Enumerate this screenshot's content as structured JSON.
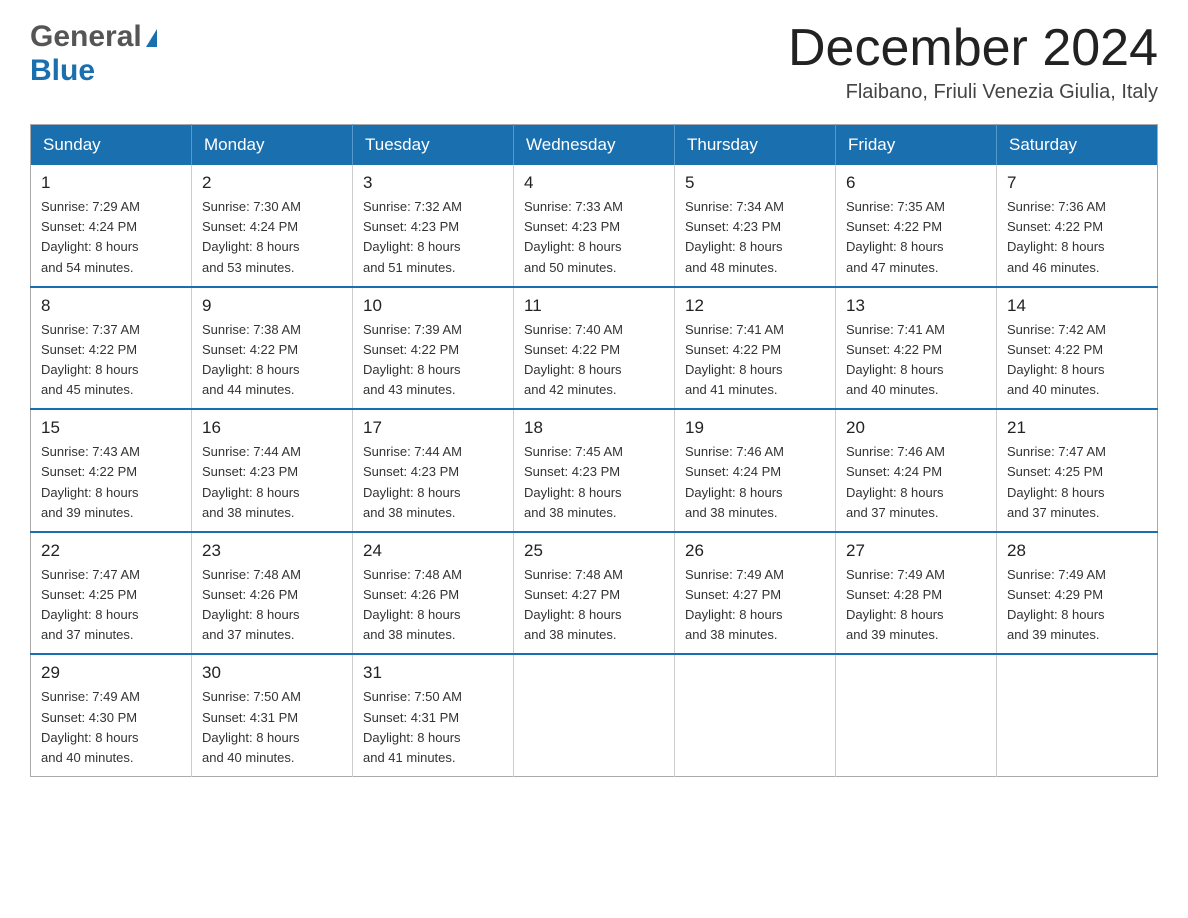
{
  "header": {
    "logo_general": "General",
    "logo_blue": "Blue",
    "month_year": "December 2024",
    "location": "Flaibano, Friuli Venezia Giulia, Italy"
  },
  "days_of_week": [
    "Sunday",
    "Monday",
    "Tuesday",
    "Wednesday",
    "Thursday",
    "Friday",
    "Saturday"
  ],
  "weeks": [
    [
      {
        "day": 1,
        "sunrise": "Sunrise: 7:29 AM",
        "sunset": "Sunset: 4:24 PM",
        "daylight": "Daylight: 8 hours",
        "daylight2": "and 54 minutes."
      },
      {
        "day": 2,
        "sunrise": "Sunrise: 7:30 AM",
        "sunset": "Sunset: 4:24 PM",
        "daylight": "Daylight: 8 hours",
        "daylight2": "and 53 minutes."
      },
      {
        "day": 3,
        "sunrise": "Sunrise: 7:32 AM",
        "sunset": "Sunset: 4:23 PM",
        "daylight": "Daylight: 8 hours",
        "daylight2": "and 51 minutes."
      },
      {
        "day": 4,
        "sunrise": "Sunrise: 7:33 AM",
        "sunset": "Sunset: 4:23 PM",
        "daylight": "Daylight: 8 hours",
        "daylight2": "and 50 minutes."
      },
      {
        "day": 5,
        "sunrise": "Sunrise: 7:34 AM",
        "sunset": "Sunset: 4:23 PM",
        "daylight": "Daylight: 8 hours",
        "daylight2": "and 48 minutes."
      },
      {
        "day": 6,
        "sunrise": "Sunrise: 7:35 AM",
        "sunset": "Sunset: 4:22 PM",
        "daylight": "Daylight: 8 hours",
        "daylight2": "and 47 minutes."
      },
      {
        "day": 7,
        "sunrise": "Sunrise: 7:36 AM",
        "sunset": "Sunset: 4:22 PM",
        "daylight": "Daylight: 8 hours",
        "daylight2": "and 46 minutes."
      }
    ],
    [
      {
        "day": 8,
        "sunrise": "Sunrise: 7:37 AM",
        "sunset": "Sunset: 4:22 PM",
        "daylight": "Daylight: 8 hours",
        "daylight2": "and 45 minutes."
      },
      {
        "day": 9,
        "sunrise": "Sunrise: 7:38 AM",
        "sunset": "Sunset: 4:22 PM",
        "daylight": "Daylight: 8 hours",
        "daylight2": "and 44 minutes."
      },
      {
        "day": 10,
        "sunrise": "Sunrise: 7:39 AM",
        "sunset": "Sunset: 4:22 PM",
        "daylight": "Daylight: 8 hours",
        "daylight2": "and 43 minutes."
      },
      {
        "day": 11,
        "sunrise": "Sunrise: 7:40 AM",
        "sunset": "Sunset: 4:22 PM",
        "daylight": "Daylight: 8 hours",
        "daylight2": "and 42 minutes."
      },
      {
        "day": 12,
        "sunrise": "Sunrise: 7:41 AM",
        "sunset": "Sunset: 4:22 PM",
        "daylight": "Daylight: 8 hours",
        "daylight2": "and 41 minutes."
      },
      {
        "day": 13,
        "sunrise": "Sunrise: 7:41 AM",
        "sunset": "Sunset: 4:22 PM",
        "daylight": "Daylight: 8 hours",
        "daylight2": "and 40 minutes."
      },
      {
        "day": 14,
        "sunrise": "Sunrise: 7:42 AM",
        "sunset": "Sunset: 4:22 PM",
        "daylight": "Daylight: 8 hours",
        "daylight2": "and 40 minutes."
      }
    ],
    [
      {
        "day": 15,
        "sunrise": "Sunrise: 7:43 AM",
        "sunset": "Sunset: 4:22 PM",
        "daylight": "Daylight: 8 hours",
        "daylight2": "and 39 minutes."
      },
      {
        "day": 16,
        "sunrise": "Sunrise: 7:44 AM",
        "sunset": "Sunset: 4:23 PM",
        "daylight": "Daylight: 8 hours",
        "daylight2": "and 38 minutes."
      },
      {
        "day": 17,
        "sunrise": "Sunrise: 7:44 AM",
        "sunset": "Sunset: 4:23 PM",
        "daylight": "Daylight: 8 hours",
        "daylight2": "and 38 minutes."
      },
      {
        "day": 18,
        "sunrise": "Sunrise: 7:45 AM",
        "sunset": "Sunset: 4:23 PM",
        "daylight": "Daylight: 8 hours",
        "daylight2": "and 38 minutes."
      },
      {
        "day": 19,
        "sunrise": "Sunrise: 7:46 AM",
        "sunset": "Sunset: 4:24 PM",
        "daylight": "Daylight: 8 hours",
        "daylight2": "and 38 minutes."
      },
      {
        "day": 20,
        "sunrise": "Sunrise: 7:46 AM",
        "sunset": "Sunset: 4:24 PM",
        "daylight": "Daylight: 8 hours",
        "daylight2": "and 37 minutes."
      },
      {
        "day": 21,
        "sunrise": "Sunrise: 7:47 AM",
        "sunset": "Sunset: 4:25 PM",
        "daylight": "Daylight: 8 hours",
        "daylight2": "and 37 minutes."
      }
    ],
    [
      {
        "day": 22,
        "sunrise": "Sunrise: 7:47 AM",
        "sunset": "Sunset: 4:25 PM",
        "daylight": "Daylight: 8 hours",
        "daylight2": "and 37 minutes."
      },
      {
        "day": 23,
        "sunrise": "Sunrise: 7:48 AM",
        "sunset": "Sunset: 4:26 PM",
        "daylight": "Daylight: 8 hours",
        "daylight2": "and 37 minutes."
      },
      {
        "day": 24,
        "sunrise": "Sunrise: 7:48 AM",
        "sunset": "Sunset: 4:26 PM",
        "daylight": "Daylight: 8 hours",
        "daylight2": "and 38 minutes."
      },
      {
        "day": 25,
        "sunrise": "Sunrise: 7:48 AM",
        "sunset": "Sunset: 4:27 PM",
        "daylight": "Daylight: 8 hours",
        "daylight2": "and 38 minutes."
      },
      {
        "day": 26,
        "sunrise": "Sunrise: 7:49 AM",
        "sunset": "Sunset: 4:27 PM",
        "daylight": "Daylight: 8 hours",
        "daylight2": "and 38 minutes."
      },
      {
        "day": 27,
        "sunrise": "Sunrise: 7:49 AM",
        "sunset": "Sunset: 4:28 PM",
        "daylight": "Daylight: 8 hours",
        "daylight2": "and 39 minutes."
      },
      {
        "day": 28,
        "sunrise": "Sunrise: 7:49 AM",
        "sunset": "Sunset: 4:29 PM",
        "daylight": "Daylight: 8 hours",
        "daylight2": "and 39 minutes."
      }
    ],
    [
      {
        "day": 29,
        "sunrise": "Sunrise: 7:49 AM",
        "sunset": "Sunset: 4:30 PM",
        "daylight": "Daylight: 8 hours",
        "daylight2": "and 40 minutes."
      },
      {
        "day": 30,
        "sunrise": "Sunrise: 7:50 AM",
        "sunset": "Sunset: 4:31 PM",
        "daylight": "Daylight: 8 hours",
        "daylight2": "and 40 minutes."
      },
      {
        "day": 31,
        "sunrise": "Sunrise: 7:50 AM",
        "sunset": "Sunset: 4:31 PM",
        "daylight": "Daylight: 8 hours",
        "daylight2": "and 41 minutes."
      },
      null,
      null,
      null,
      null
    ]
  ]
}
